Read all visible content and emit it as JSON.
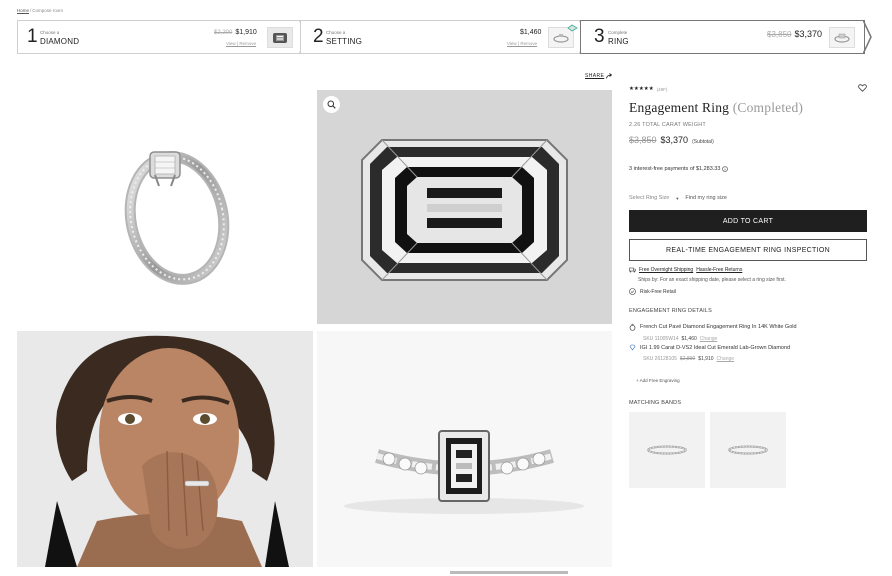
{
  "breadcrumb": {
    "home": "Home",
    "sep": "/",
    "current": "Compose room"
  },
  "steps": [
    {
      "number": "1",
      "small": "Choose a",
      "label": "DIAMOND",
      "old_price": "$2,200",
      "price": "$1,910",
      "links": "View | Remove"
    },
    {
      "number": "2",
      "small": "Choose a",
      "label": "SETTING",
      "price": "$1,460",
      "links": "View | Remove"
    },
    {
      "number": "3",
      "small": "Complete",
      "label": "RING",
      "old_price": "$3,850",
      "price": "$3,370"
    }
  ],
  "share_label": "SHARE",
  "product": {
    "rating_count": "(49F)",
    "title": "Engagement Ring",
    "title_status": "(Completed)",
    "carat_weight": "2.26 TOTAL CARAT WEIGHT",
    "old_price": "$3,850",
    "price": "$3,370",
    "subtotal_label": "(Subtotal)",
    "installments": "3 interest-free payments of $1,283.33",
    "ring_size_placeholder": "Select Ring Size",
    "find_size": "Find my ring size",
    "add_to_cart": "ADD TO CART",
    "inspection": "REAL-TIME ENGAGEMENT RING INSPECTION",
    "free_shipping": "Free Overnight Shipping",
    "free_returns": "Hassle-Free Returns",
    "ships_by": "Ships by: For an exact shipping date, please select a ring size first.",
    "risk_free": "Risk-Free Retail"
  },
  "details": {
    "heading": "ENGAGEMENT RING DETAILS",
    "items": [
      {
        "name": "French Cut Pavé Diamond Engagement Ring In 14K White Gold",
        "sku": "SKU 11005W14",
        "price": "$1,460",
        "change": "Change"
      },
      {
        "name": "IGI 1.99 Carat D-VS2 Ideal Cut Emerald Lab-Grown Diamond",
        "sku": "SKU 26128105",
        "old_price": "$2,890",
        "price": "$1,910",
        "change": "Change"
      }
    ],
    "engraving": "+ Add Free Engraving"
  },
  "matching_bands_heading": "MATCHING BANDS",
  "colors": {
    "primary_button": "#1f1f1f",
    "text": "#222222",
    "muted": "#999999"
  }
}
